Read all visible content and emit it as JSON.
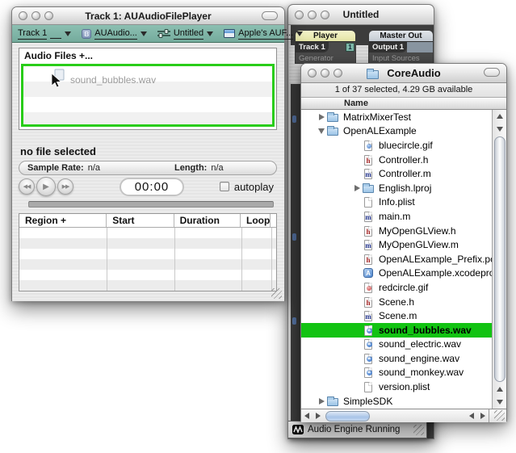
{
  "player_window": {
    "title": "Track 1: AUAudioFilePlayer",
    "toolbar": [
      {
        "label": "Track 1",
        "icon": "none"
      },
      {
        "label": "AUAudio...",
        "icon": "component"
      },
      {
        "label": "Untitled",
        "icon": "sliders"
      },
      {
        "label": "Apple's AUF...",
        "icon": "window"
      }
    ],
    "audio_files_header": "Audio Files +...",
    "dragged_file": "sound_bubbles.wav",
    "no_file_text": "no file selected",
    "sample_rate_label": "Sample Rate:",
    "sample_rate_value": "n/a",
    "length_label": "Length:",
    "length_value": "n/a",
    "rewind_glyph": "◀◀",
    "play_glyph": "▶",
    "forward_glyph": "▶▶",
    "time_display": "00:00",
    "autoplay_label": "autoplay",
    "table_headers": [
      "Region +",
      "Start",
      "Duration",
      "Loop"
    ],
    "empty_table_rows": 6
  },
  "untitled_window": {
    "title": "Untitled",
    "tracks": [
      {
        "header": "Player",
        "tab": "Track 1",
        "badge": "1",
        "sub": "Generator"
      },
      {
        "header": "Master Out",
        "tab": "Output 1",
        "badge": "",
        "sub": "Input Sources"
      }
    ],
    "status": "Audio Engine Running"
  },
  "finder_window": {
    "title": "CoreAudio",
    "status": "1 of 37 selected, 4.29 GB available",
    "column": "Name",
    "rows": [
      {
        "name": "MatrixMixerTest",
        "icon": "folder",
        "level": 1,
        "disclosure": "collapsed"
      },
      {
        "name": "OpenALExample",
        "icon": "folder",
        "level": 1,
        "disclosure": "expanded"
      },
      {
        "name": "bluecircle.gif",
        "icon": "gif-blue",
        "level": 2
      },
      {
        "name": "Controller.h",
        "icon": "header",
        "level": 2
      },
      {
        "name": "Controller.m",
        "icon": "objc",
        "level": 2
      },
      {
        "name": "English.lproj",
        "icon": "folder",
        "level": 2,
        "disclosure": "collapsed"
      },
      {
        "name": "Info.plist",
        "icon": "doc",
        "level": 2
      },
      {
        "name": "main.m",
        "icon": "objc",
        "level": 2
      },
      {
        "name": "MyOpenGLView.h",
        "icon": "header",
        "level": 2
      },
      {
        "name": "MyOpenGLView.m",
        "icon": "objc",
        "level": 2
      },
      {
        "name": "OpenALExample_Prefix.pch",
        "icon": "header",
        "level": 2
      },
      {
        "name": "OpenALExample.xcodeproj",
        "icon": "xcode",
        "level": 2
      },
      {
        "name": "redcircle.gif",
        "icon": "gif-red",
        "level": 2
      },
      {
        "name": "Scene.h",
        "icon": "header",
        "level": 2
      },
      {
        "name": "Scene.m",
        "icon": "objc",
        "level": 2
      },
      {
        "name": "sound_bubbles.wav",
        "icon": "wav",
        "level": 2,
        "selected": true
      },
      {
        "name": "sound_electric.wav",
        "icon": "wav",
        "level": 2
      },
      {
        "name": "sound_engine.wav",
        "icon": "wav",
        "level": 2
      },
      {
        "name": "sound_monkey.wav",
        "icon": "wav",
        "level": 2
      },
      {
        "name": "version.plist",
        "icon": "doc",
        "level": 2
      },
      {
        "name": "SimpleSDK",
        "icon": "folder",
        "level": 1,
        "disclosure": "collapsed"
      }
    ],
    "colors": {
      "selection_green": "#12c312",
      "drop_border_green": "#29cd19",
      "toolbar_teal": "#7cb5a6"
    }
  }
}
